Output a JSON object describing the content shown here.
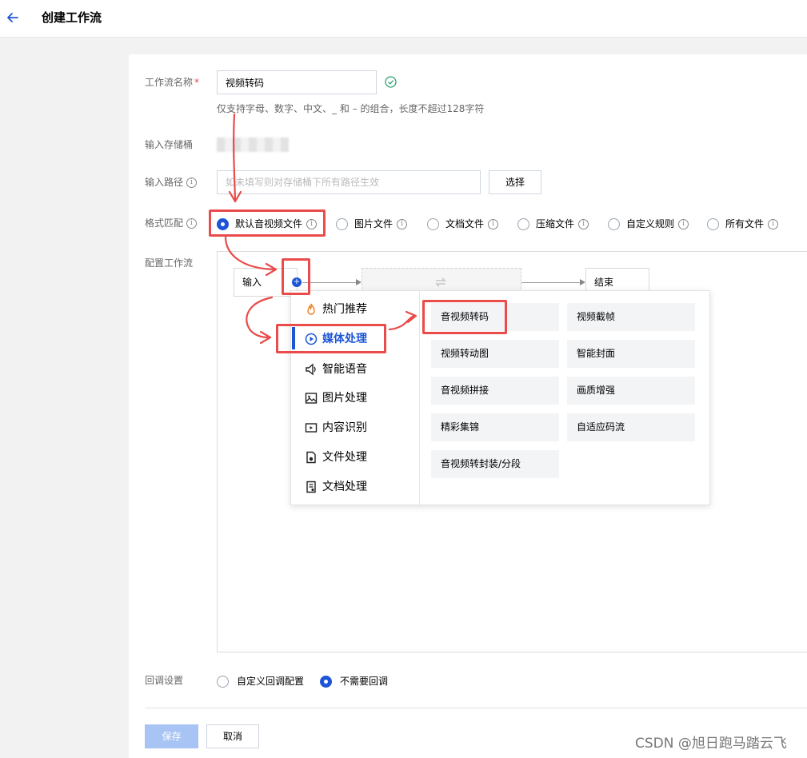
{
  "header": {
    "title": "创建工作流"
  },
  "form": {
    "name_label": "工作流名称",
    "required_mark": "*",
    "name_value": "视频转码",
    "name_hint": "仅支持字母、数字、中文、_ 和 – 的组合，长度不超过128字符",
    "bucket_label": "输入存储桶",
    "path_label": "输入路径",
    "path_placeholder": "如未填写则对存储桶下所有路径生效",
    "select_button": "选择",
    "format_label": "格式匹配",
    "format_options": [
      {
        "label": "默认音视频文件",
        "selected": true
      },
      {
        "label": "图片文件",
        "selected": false
      },
      {
        "label": "文档文件",
        "selected": false
      },
      {
        "label": "压缩文件",
        "selected": false
      },
      {
        "label": "自定义规则",
        "selected": false
      },
      {
        "label": "所有文件",
        "selected": false
      }
    ],
    "workflow_label": "配置工作流",
    "callback_label": "回调设置",
    "callback_options": [
      {
        "label": "自定义回调配置",
        "selected": false
      },
      {
        "label": "不需要回调",
        "selected": true
      }
    ],
    "save_button": "保存",
    "cancel_button": "取消"
  },
  "workflow": {
    "input_node": "输入",
    "end_node": "结束",
    "plus_symbol": "+",
    "categories": [
      {
        "label": "热门推荐",
        "icon": "fire-icon"
      },
      {
        "label": "媒体处理",
        "icon": "media-play-icon",
        "active": true
      },
      {
        "label": "智能语音",
        "icon": "speaker-icon"
      },
      {
        "label": "图片处理",
        "icon": "image-icon"
      },
      {
        "label": "内容识别",
        "icon": "video-icon"
      },
      {
        "label": "文件处理",
        "icon": "file-gear-icon"
      },
      {
        "label": "文档处理",
        "icon": "doc-icon"
      }
    ],
    "items": [
      "音视频转码",
      "视频截帧",
      "视频转动图",
      "智能封面",
      "音视频拼接",
      "画质增强",
      "精彩集锦",
      "自适应码流",
      "音视频转封装/分段"
    ]
  },
  "info_symbol": "i",
  "watermark": "CSDN @旭日跑马踏云飞",
  "colors": {
    "accent": "#1c55d6",
    "annotation": "#ea4b4b",
    "success": "#2ba471"
  }
}
